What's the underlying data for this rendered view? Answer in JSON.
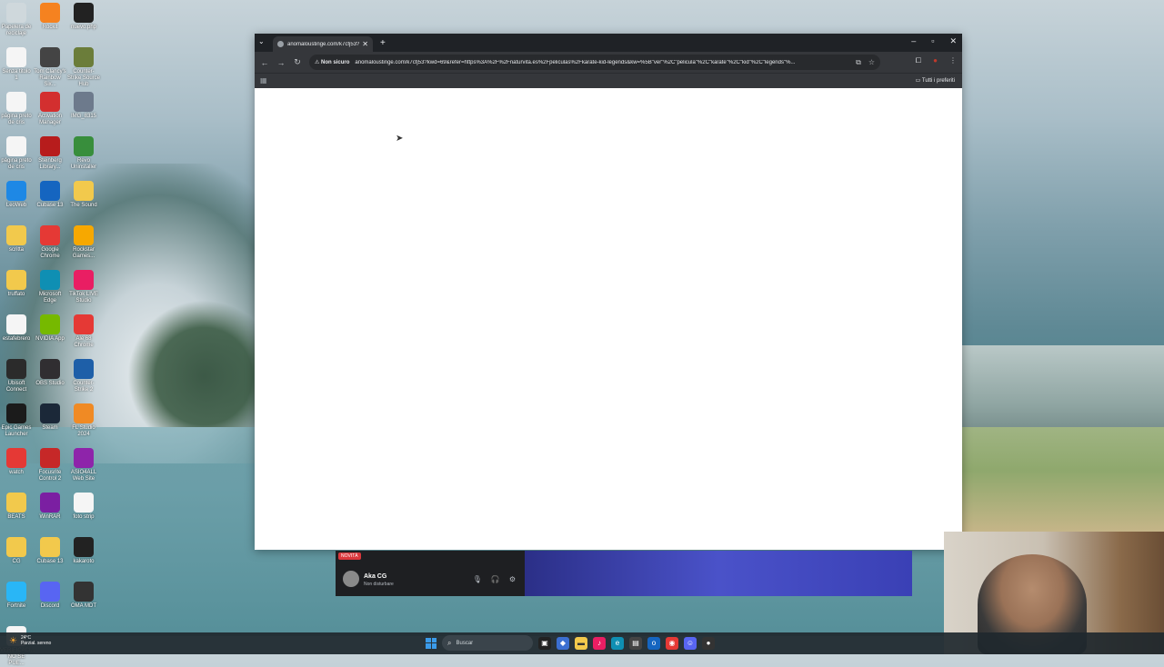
{
  "desktop": {
    "icons": [
      {
        "label": "Papelera de reciclaje",
        "icon": "recycle-bin-icon",
        "color": "#cfd8dc"
      },
      {
        "label": "Rockit",
        "icon": "vlc-icon",
        "color": "#f58220"
      },
      {
        "label": "nuevo.php",
        "icon": "file-icon",
        "color": "#222"
      },
      {
        "label": "Senza titolo 1",
        "icon": "document-icon",
        "color": "#f5f5f5"
      },
      {
        "label": "Tom Clancy's Rainbow Six...",
        "icon": "game-icon",
        "color": "#444"
      },
      {
        "label": "Counter-Strike Source Hub",
        "icon": "cs-icon",
        "color": "#6b7d3a"
      },
      {
        "label": "página preto de cris",
        "icon": "document-icon",
        "color": "#f5f5f5"
      },
      {
        "label": "Activation Manager",
        "icon": "activation-icon",
        "color": "#d32f2f"
      },
      {
        "label": "IMG_8315",
        "icon": "image-icon",
        "color": "#6d7a8c"
      },
      {
        "label": "página preto de cris",
        "icon": "document-icon",
        "color": "#f5f5f5"
      },
      {
        "label": "Steinberg Library...",
        "icon": "library-icon",
        "color": "#b71c1c"
      },
      {
        "label": "Revo Uninstaller",
        "icon": "uninstaller-icon",
        "color": "#388e3c"
      },
      {
        "label": "LeoWeb",
        "icon": "app-icon",
        "color": "#1e88e5"
      },
      {
        "label": "Cubase 13",
        "icon": "cubase-icon",
        "color": "#1565c0"
      },
      {
        "label": "The Sound",
        "icon": "folder-icon",
        "color": "#f2c94c"
      },
      {
        "label": "scritta",
        "icon": "folder-icon",
        "color": "#f2c94c"
      },
      {
        "label": "Google Chrome",
        "icon": "chrome-icon",
        "color": "#e53935"
      },
      {
        "label": "Rockstar Games...",
        "icon": "rockstar-icon",
        "color": "#f7a800"
      },
      {
        "label": "truffato",
        "icon": "folder-icon",
        "color": "#f2c94c"
      },
      {
        "label": "Microsoft Edge",
        "icon": "edge-icon",
        "color": "#0f8fb3"
      },
      {
        "label": "TikTok LIVE Studio",
        "icon": "tiktok-icon",
        "color": "#e91e63"
      },
      {
        "label": "estafebrero",
        "icon": "document-icon",
        "color": "#f5f5f5"
      },
      {
        "label": "NVIDIA App",
        "icon": "nvidia-icon",
        "color": "#76b900"
      },
      {
        "label": "Ale 68 Chrome",
        "icon": "chrome-icon",
        "color": "#e53935"
      },
      {
        "label": "Ubisoft Connect",
        "icon": "ubisoft-icon",
        "color": "#2b2b2b"
      },
      {
        "label": "OBS Studio",
        "icon": "obs-icon",
        "color": "#302e31"
      },
      {
        "label": "Counter-Strike 2",
        "icon": "cs2-icon",
        "color": "#1e5fa8"
      },
      {
        "label": "Epic Games Launcher",
        "icon": "epic-icon",
        "color": "#1b1b1b"
      },
      {
        "label": "Steam",
        "icon": "steam-icon",
        "color": "#1b2838"
      },
      {
        "label": "FL Studio 2024",
        "icon": "fl-studio-icon",
        "color": "#f08a24"
      },
      {
        "label": "watch",
        "icon": "chrome-icon",
        "color": "#e53935"
      },
      {
        "label": "Focusrite Control 2",
        "icon": "focusrite-icon",
        "color": "#c62828"
      },
      {
        "label": "ASIO4ALL Web Site",
        "icon": "asio-icon",
        "color": "#8e24aa"
      },
      {
        "label": "BEATS",
        "icon": "folder-icon",
        "color": "#f2c94c"
      },
      {
        "label": "WinRAR",
        "icon": "winrar-icon",
        "color": "#7b1fa2"
      },
      {
        "label": "foto strip",
        "icon": "document-icon",
        "color": "#f5f5f5"
      },
      {
        "label": "CG",
        "icon": "folder-icon",
        "color": "#f2c94c"
      },
      {
        "label": "Cubase 13",
        "icon": "folder-icon",
        "color": "#f2c94c"
      },
      {
        "label": "kakaroto",
        "icon": "file-icon",
        "color": "#222"
      },
      {
        "label": "Fortnite",
        "icon": "fortnite-icon",
        "color": "#29b6f6"
      },
      {
        "label": "Discord",
        "icon": "discord-icon",
        "color": "#5865f2"
      },
      {
        "label": "OMA MDT",
        "icon": "app-icon",
        "color": "#333"
      },
      {
        "label": "VERIFICACI... NO SE PUE...",
        "icon": "document-icon",
        "color": "#f5f5f5"
      }
    ]
  },
  "browser": {
    "tab_title": "anomaloustinge.com/k7cfj53?",
    "new_tab": "+",
    "security_label": "Non sicuro",
    "url": "anomaloustinge.com/k7cfj53?kwd=69&refer=https%3A%2F%2Fnaturvita.es%2Fpeliculas%2Fkarate-kid-legends&kw=%5B\"ver\"%2C\"pelicula\"%2C\"karate\"%2C\"kid\"%2C\"legends\"%...",
    "bookmarks_all": "Tutti i preferiti"
  },
  "discord": {
    "badge": "NOVITÀ",
    "username": "Aka CG",
    "status": "Non disturbare"
  },
  "taskbar": {
    "weather_temp": "24°C",
    "weather_desc": "Parzial. sereno",
    "search_placeholder": "Buscar"
  }
}
